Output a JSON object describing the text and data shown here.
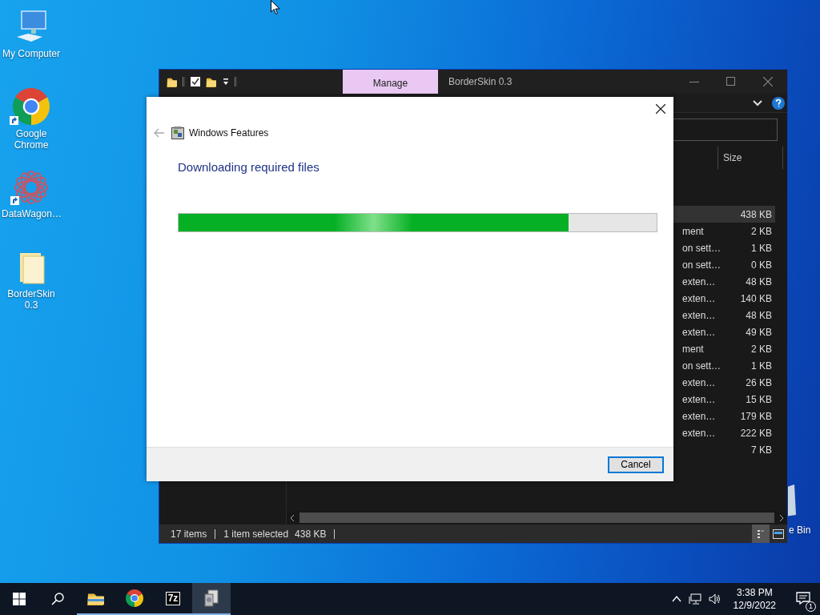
{
  "desktop_icons": [
    {
      "label": "My Computer",
      "kind": "computer",
      "shortcut": false
    },
    {
      "label": "Google Chrome",
      "kind": "browser",
      "shortcut": true
    },
    {
      "label": "DataWagon…",
      "kind": "app",
      "shortcut": true
    },
    {
      "label": "BorderSkin 0.3",
      "kind": "folder",
      "shortcut": false
    }
  ],
  "recycle_bin": {
    "label": "e Bin"
  },
  "explorer": {
    "ribbon_tab": {
      "label": "Manage"
    },
    "title": "BorderSkin 0.3",
    "columns": [
      {
        "label": "Size"
      }
    ],
    "rows": [
      {
        "size": "438 KB",
        "selected": true
      },
      {
        "type": "ment",
        "size": "2 KB",
        "selected": false
      },
      {
        "type": "on sett…",
        "size": "1 KB",
        "selected": false
      },
      {
        "type": "on sett…",
        "size": "0 KB",
        "selected": false
      },
      {
        "type": "exten…",
        "size": "48 KB",
        "selected": false
      },
      {
        "type": "exten…",
        "size": "140 KB",
        "selected": false
      },
      {
        "type": "exten…",
        "size": "48 KB",
        "selected": false
      },
      {
        "type": "exten…",
        "size": "49 KB",
        "selected": false
      },
      {
        "type": "ment",
        "size": "2 KB",
        "selected": false
      },
      {
        "type": "on sett…",
        "size": "1 KB",
        "selected": false
      },
      {
        "type": "exten…",
        "size": "26 KB",
        "selected": false
      },
      {
        "type": "exten…",
        "size": "15 KB",
        "selected": false
      },
      {
        "type": "exten…",
        "size": "179 KB",
        "selected": false
      },
      {
        "type": "exten…",
        "size": "222 KB",
        "selected": false
      },
      {
        "size": "7 KB",
        "selected": false
      }
    ],
    "status_bar": {
      "item_count": "17 items",
      "selection": "1 item selected",
      "selection_size": "438 KB"
    }
  },
  "dialog": {
    "title": "Windows Features",
    "heading": "Downloading required files",
    "progress": {
      "level": 0.816
    },
    "buttons": [
      {
        "label": "Cancel",
        "default": true
      }
    ]
  },
  "taskbar": {
    "apps": [
      {
        "kind": "folder",
        "running": true,
        "active": false
      },
      {
        "kind": "browser",
        "running": true,
        "active": false
      },
      {
        "kind": "archiver",
        "icon_text": "7z",
        "running": true,
        "active": false
      },
      {
        "kind": "installer",
        "running": true,
        "active": true
      }
    ],
    "clock": {
      "time": "3:38 PM",
      "date": "12/9/2022"
    },
    "notifications": {
      "count": "1"
    }
  }
}
